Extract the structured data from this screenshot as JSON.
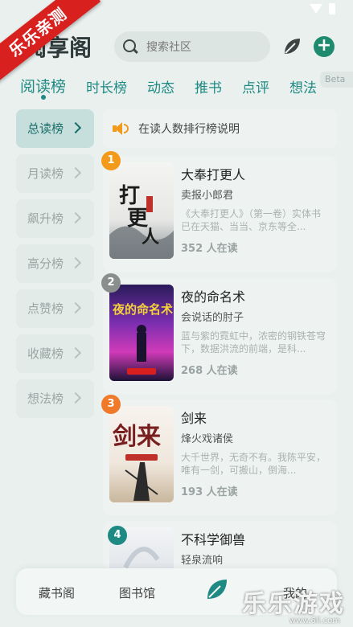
{
  "ribbon": "乐乐亲测",
  "header": {
    "title": "阅享阁",
    "search_placeholder": "搜索社区",
    "add_label": "+"
  },
  "tabs": [
    {
      "label": "阅读榜"
    },
    {
      "label": "时长榜"
    },
    {
      "label": "动态"
    },
    {
      "label": "推书"
    },
    {
      "label": "点评"
    },
    {
      "label": "想法"
    }
  ],
  "beta": "Beta",
  "menu": [
    {
      "label": "总读榜"
    },
    {
      "label": "月读榜"
    },
    {
      "label": "飙升榜"
    },
    {
      "label": "高分榜"
    },
    {
      "label": "点赞榜"
    },
    {
      "label": "收藏榜"
    },
    {
      "label": "想法榜"
    }
  ],
  "notice": "在读人数排行榜说明",
  "books": [
    {
      "rank": "1",
      "title": "大奉打更人",
      "author": "卖报小郎君",
      "desc": "《大奉打更人》（第一卷）实体书已在天猫、当当、京东等全...",
      "readers": "352 人在读",
      "rank_color": "#f39a1a",
      "cover_text": "打更人"
    },
    {
      "rank": "2",
      "title": "夜的命名术",
      "author": "会说话的肘子",
      "desc": "蓝与紫的霓虹中，浓密的钢铁苍穹下，数据洪流的前端，是科...",
      "readers": "268 人在读",
      "rank_color": "#8a8f8e",
      "cover_text": "夜的命名术"
    },
    {
      "rank": "3",
      "title": "剑来",
      "author": "烽火戏诸侯",
      "desc": "大千世界，无奇不有。我陈平安，唯有一剑，可搬山，倒海...",
      "readers": "193 人在读",
      "rank_color": "#f07a2a",
      "cover_text": "剑来"
    },
    {
      "rank": "4",
      "title": "不科学御兽",
      "author": "轻泉流响",
      "desc": "",
      "readers": "",
      "rank_color": "#1f8a83",
      "cover_text": ""
    }
  ],
  "bottom_nav": [
    {
      "label": "藏书阁"
    },
    {
      "label": "图书馆"
    },
    {
      "label": "我的"
    }
  ],
  "watermark": {
    "main": "乐乐游戏",
    "sub": "www.6ll.com"
  },
  "colors": {
    "accent": "#1f8a83",
    "brand_green": "#1e8a6e",
    "ribbon": "#d8211f"
  }
}
